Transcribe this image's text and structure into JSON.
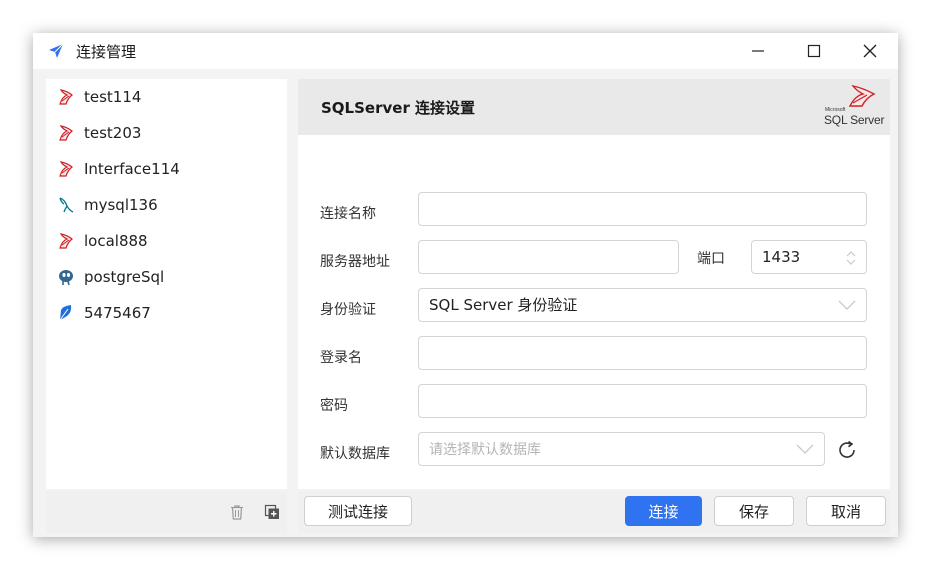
{
  "window": {
    "title": "连接管理",
    "minimize_icon": "minimize-icon",
    "maximize_icon": "maximize-icon",
    "close_icon": "close-icon"
  },
  "sidebar": {
    "items": [
      {
        "label": "test114",
        "icon": "sqlserver-icon"
      },
      {
        "label": "test203",
        "icon": "sqlserver-icon"
      },
      {
        "label": "Interface114",
        "icon": "sqlserver-icon"
      },
      {
        "label": "mysql136",
        "icon": "mysql-icon"
      },
      {
        "label": "local888",
        "icon": "sqlserver-icon"
      },
      {
        "label": "postgreSql",
        "icon": "postgresql-icon"
      },
      {
        "label": "5475467",
        "icon": "feather-icon"
      }
    ],
    "tools": {
      "delete_icon": "trash-icon",
      "add_icon": "add-copy-icon"
    }
  },
  "panel": {
    "title": "SQLServer 连接设置",
    "logo": {
      "brand": "Microsoft",
      "text": "SQL Server"
    }
  },
  "form": {
    "name_label": "连接名称",
    "name_value": "",
    "server_label": "服务器地址",
    "server_value": "",
    "port_label": "端口",
    "port_value": "1433",
    "auth_label": "身份验证",
    "auth_value": "SQL Server 身份验证",
    "login_label": "登录名",
    "login_value": "",
    "password_label": "密码",
    "password_value": "",
    "db_label": "默认数据库",
    "db_placeholder": "请选择默认数据库"
  },
  "buttons": {
    "test": "测试连接",
    "connect": "连接",
    "save": "保存",
    "cancel": "取消"
  },
  "colors": {
    "primary": "#2f73f0",
    "sqlserver_red": "#cc2027",
    "mysql_blue": "#00758f",
    "postgres_blue": "#336791"
  }
}
